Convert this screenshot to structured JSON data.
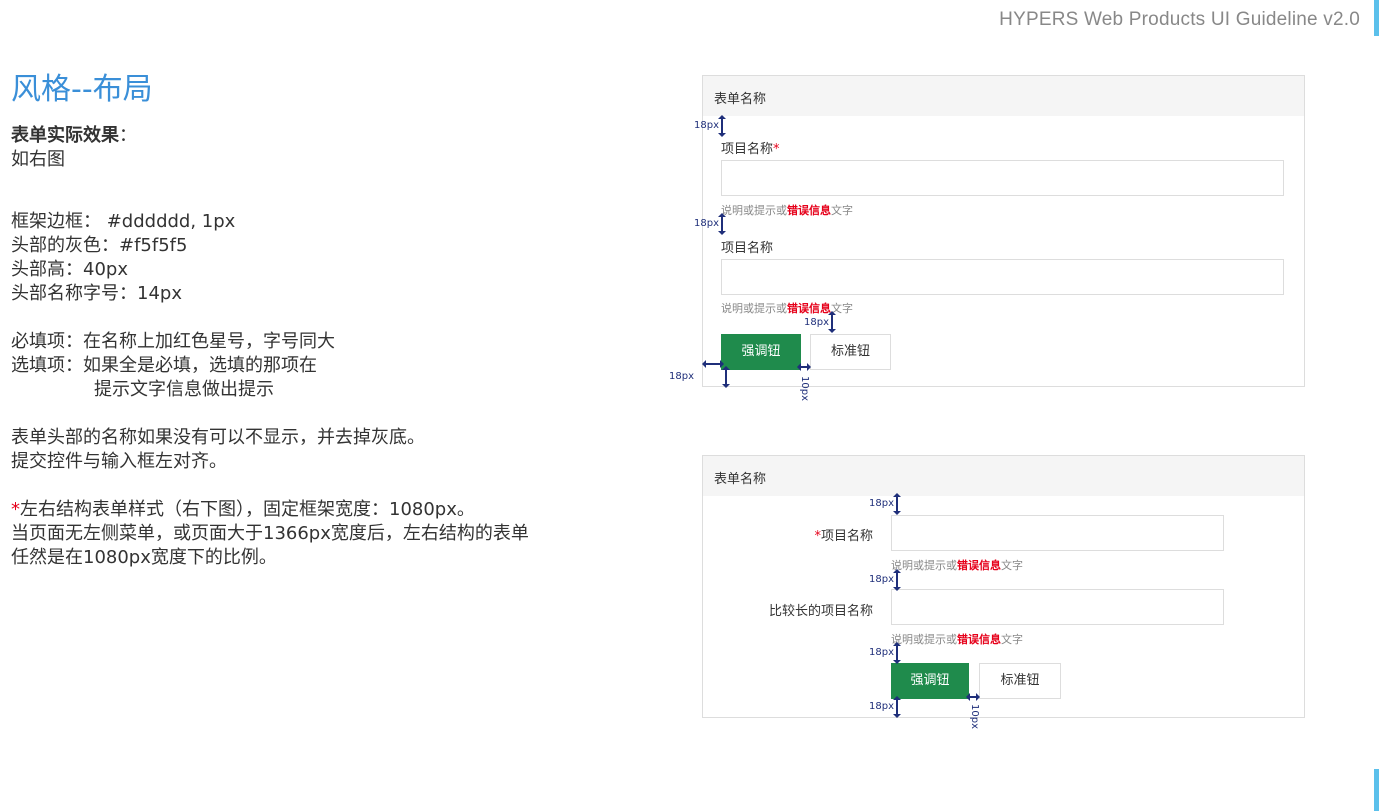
{
  "header": {
    "brand": "HYPERS Web Products UI Guideline v2.0"
  },
  "page": {
    "title": "风格--布局"
  },
  "description": {
    "heading": "表单实际效果",
    "heading_suffix": "：",
    "line_see": "如右图",
    "line_border": "框架边框： #dddddd, 1px",
    "line_head_color": "头部的灰色：#f5f5f5",
    "line_head_height": "头部高：40px",
    "line_head_font": "头部名称字号：14px",
    "line_required": "必填项：在名称上加红色星号，字号同大",
    "line_optional_1": "选填项：如果全是必填，选填的那项在",
    "line_optional_2": "提示文字信息做出提示",
    "line_head_hide": "表单头部的名称如果没有可以不显示，并去掉灰底。",
    "line_align": "提交控件与输入框左对齐。",
    "line_lr_star": "*",
    "line_lr": "左右结构表单样式（右下图），固定框架宽度：1080px。",
    "line_lr_2": "当页面无左侧菜单，或页面大于1366px宽度后，左右结构的表单",
    "line_lr_3": "任然是在1080px宽度下的比例。"
  },
  "form_top": {
    "title": "表单名称",
    "field1_label": "项目名称",
    "required_mark": "*",
    "field2_label": "项目名称",
    "hint_prefix": "说明或提示或",
    "hint_error": "错误信息",
    "hint_suffix": "文字",
    "primary_button": "强调钮",
    "default_button": "标准钮"
  },
  "form_bottom": {
    "title": "表单名称",
    "field1_label": "项目名称",
    "required_mark": "*",
    "field2_label": "比较长的项目名称",
    "hint_prefix": "说明或提示或",
    "hint_error": "错误信息",
    "hint_suffix": "文字",
    "primary_button": "强调钮",
    "default_button": "标准钮"
  },
  "dims": {
    "d18": "18px",
    "d10": "10px"
  },
  "colors": {
    "accent": "#5bc0eb",
    "title_blue": "#3a8fd8",
    "primary_green": "#1f8b4c",
    "error_red": "#e6001a",
    "border": "#dddddd",
    "head_gray": "#f5f5f5"
  }
}
